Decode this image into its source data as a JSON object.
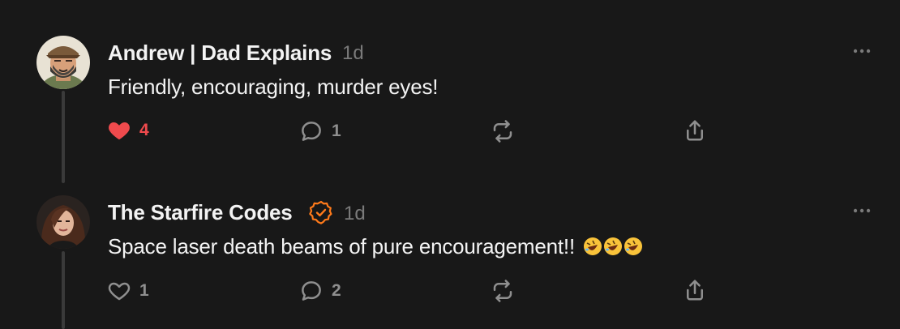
{
  "comments": [
    {
      "author": "Andrew | Dad Explains",
      "time": "1d",
      "text": "Friendly, encouraging, murder eyes!",
      "likes": "4",
      "liked": true,
      "replies": "1",
      "verified": false
    },
    {
      "author": "The Starfire Codes",
      "time": "1d",
      "text": "Space laser death beams of pure encouragement!!",
      "emoji": "🤣🤣🤣",
      "likes": "1",
      "liked": false,
      "replies": "2",
      "verified": true
    }
  ],
  "colors": {
    "background": "#181818",
    "like_active": "#ef4a4d",
    "verified_accent": "#ff7a1a",
    "muted": "#8f8f8f"
  },
  "icons": [
    "heart-icon",
    "comment-bubble-icon",
    "restack-icon",
    "share-icon",
    "more-icon",
    "verified-badge-icon"
  ]
}
